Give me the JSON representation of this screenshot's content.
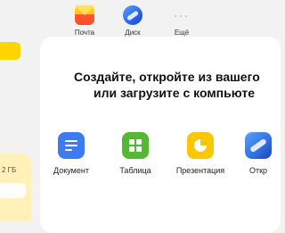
{
  "top_apps": [
    {
      "label": "Почта",
      "icon": "mail-icon"
    },
    {
      "label": "Диск",
      "icon": "disk-icon"
    },
    {
      "label": "Ещё",
      "icon": "more-dots-icon"
    }
  ],
  "storage": {
    "text": "2 ГБ"
  },
  "main": {
    "headline_line1": "Создайте, откройте из вашего",
    "headline_line2": "или загрузите с компьюте"
  },
  "tiles": [
    {
      "label": "Документ",
      "icon": "document-icon",
      "color": "#3d7bf5"
    },
    {
      "label": "Таблица",
      "icon": "spreadsheet-icon",
      "color": "#53b832"
    },
    {
      "label": "Презентация",
      "icon": "presentation-icon",
      "color": "#fcc600"
    },
    {
      "label": "Откр",
      "icon": "open-disk-icon",
      "color": "#2f6fe0"
    }
  ],
  "colors": {
    "accent_yellow": "#ffd400",
    "mail_red": "#f84a31",
    "background": "#f2f2f2"
  }
}
